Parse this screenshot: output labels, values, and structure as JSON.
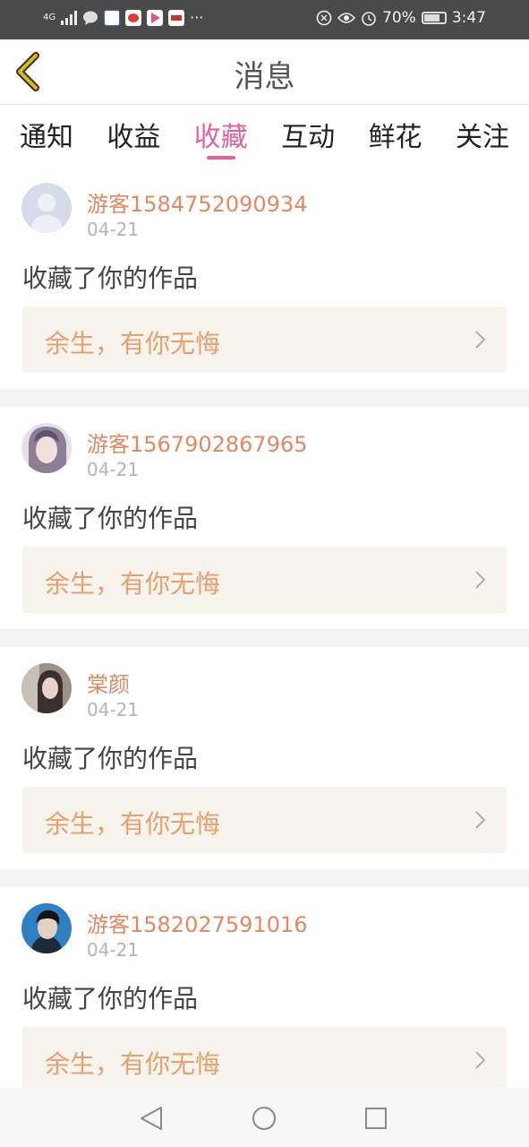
{
  "status_bar": {
    "network": "4G",
    "battery": "70%",
    "time": "3:47",
    "more": "···"
  },
  "header": {
    "title": "消息"
  },
  "tabs": [
    {
      "label": "通知",
      "active": false
    },
    {
      "label": "收益",
      "active": false
    },
    {
      "label": "收藏",
      "active": true
    },
    {
      "label": "互动",
      "active": false
    },
    {
      "label": "鲜花",
      "active": false
    },
    {
      "label": "关注",
      "active": false
    }
  ],
  "items": [
    {
      "user": "游客1584752090934",
      "date": "04-21",
      "action": "收藏了你的作品",
      "work": "余生，有你无悔"
    },
    {
      "user": "游客1567902867965",
      "date": "04-21",
      "action": "收藏了你的作品",
      "work": "余生，有你无悔"
    },
    {
      "user": "棠颜",
      "date": "04-21",
      "action": "收藏了你的作品",
      "work": "余生，有你无悔"
    },
    {
      "user": "游客1582027591016",
      "date": "04-21",
      "action": "收藏了你的作品",
      "work": "余生，有你无悔"
    }
  ],
  "colors": {
    "accent": "#e0639f",
    "username": "#e08a63",
    "work_title": "#e8a06e",
    "back_icon": "#e3b21c"
  }
}
